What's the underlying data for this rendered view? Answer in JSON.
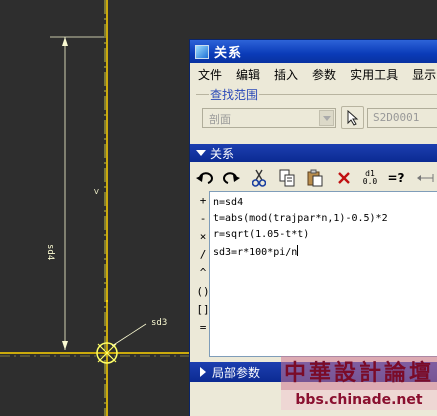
{
  "canvas": {
    "dimension_label": "sd4",
    "dimension_symbol": "V",
    "point_label": "sd3",
    "colors": {
      "background": "#2e2e2e",
      "geometry": "#f2ea46",
      "dimension": "#fafad2",
      "axis": "#ffd400"
    }
  },
  "dialog": {
    "title": "关系",
    "menu": [
      "文件",
      "编辑",
      "插入",
      "参数",
      "实用工具",
      "显示"
    ],
    "scope": {
      "label": "查找范围",
      "combo_value": "剖面",
      "selection_value": "S2D0001"
    },
    "relations_section_label": "关系",
    "toolbar": {
      "undo_icon": "undo-icon",
      "redo_icon": "redo-icon",
      "cut_icon": "scissors-icon",
      "copy_icon": "copy-icon",
      "paste_icon": "paste-icon",
      "delete_icon": "delete-icon",
      "switch_dims_top": "d1",
      "switch_dims_bottom": "0.0",
      "evaluate_label": "=?"
    },
    "operators": [
      "+",
      "-",
      "×",
      "/",
      "^",
      "()",
      "[]",
      "="
    ],
    "relations": [
      "n=sd4",
      "t=abs(mod(trajpar*n,1)-0.5)*2",
      "r=sqrt(1.05-t*t)",
      "sd3=r*100*pi/n"
    ],
    "local_params_label": "局部参数"
  },
  "watermark": {
    "top": "中華設計論壇",
    "bottom": "bbs.chinade.net"
  }
}
